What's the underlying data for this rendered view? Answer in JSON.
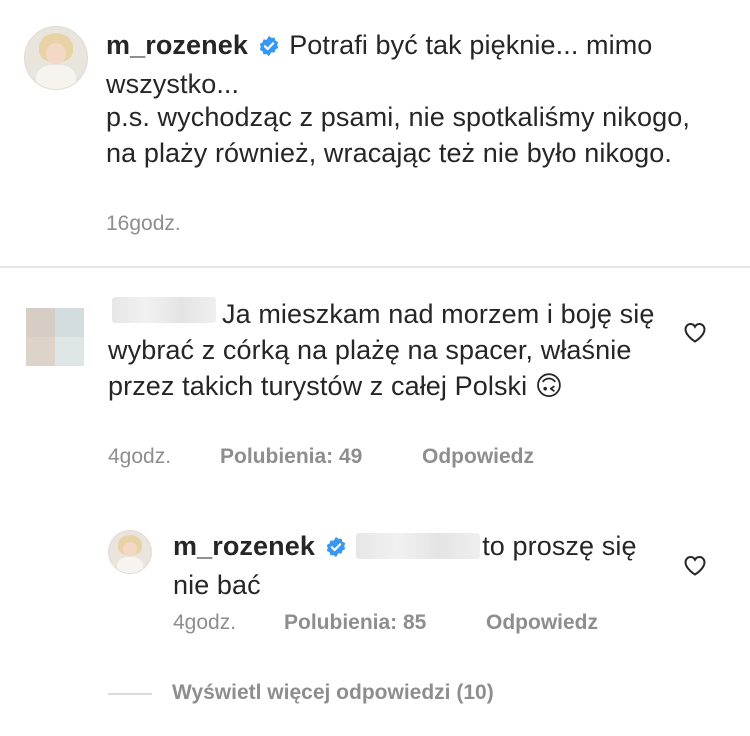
{
  "caption": {
    "username": "m_rozenek",
    "text": "Potrafi być tak pięknie... mimo wszystko...",
    "text2": "p.s. wychodząc z psami, nie spotkaliśmy nikogo, na plaży również, wracając też nie było nikogo.",
    "time": "16godz."
  },
  "comment": {
    "text": "Ja mieszkam nad morzem i boję się wybrać z córką na plażę na spacer, właśnie przez takich turystów z całej Polski",
    "emoji": "🙃",
    "time": "4godz.",
    "likes": "Polubienia: 49",
    "reply_label": "Odpowiedz"
  },
  "reply": {
    "username": "m_rozenek",
    "text": "to proszę się nie bać",
    "time": "4godz.",
    "likes": "Polubienia: 85",
    "reply_label": "Odpowiedz"
  },
  "view_more": "Wyświetl więcej odpowiedzi (10)",
  "icons": {
    "verified": "verified-badge-icon",
    "like": "heart-icon"
  },
  "colors": {
    "verified": "#3897f0",
    "meta": "#8e8e8e",
    "text": "#262626"
  }
}
